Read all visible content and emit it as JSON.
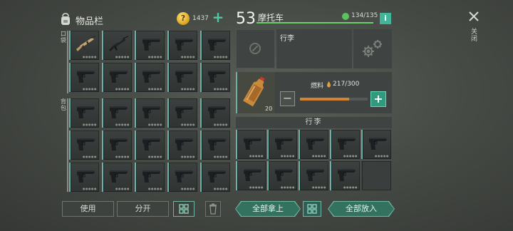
{
  "inventory": {
    "title": "物品栏",
    "coins": "1437",
    "pocket_label": "口袋",
    "backpack_label": "背包"
  },
  "actions_left": {
    "use": "使用",
    "split": "分开"
  },
  "vehicle": {
    "level": "53",
    "name": "摩托车",
    "capacity": "134/135",
    "capacity_fraction": 0.99,
    "close_label": "关闭",
    "slot_label": "行李",
    "fuel": {
      "label": "燃料",
      "value": "217/300",
      "fraction": 0.723,
      "item_qty": "20"
    },
    "cargo_title": "行李"
  },
  "actions_right": {
    "take_all": "全部拿上",
    "put_all": "全部放入"
  },
  "colors": {
    "accent": "#4ec9a8",
    "fuel": "#d7822c",
    "capacity": "#6ad06b"
  }
}
